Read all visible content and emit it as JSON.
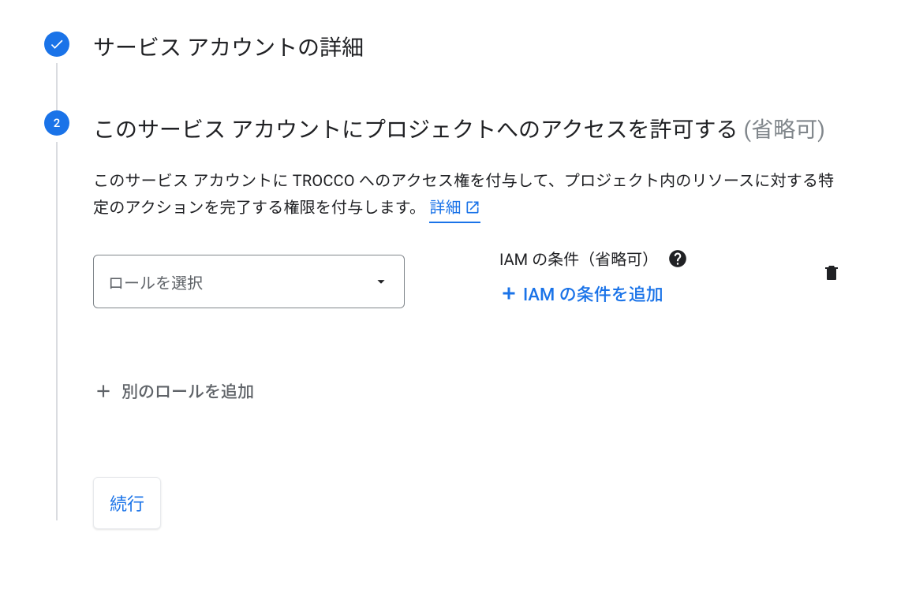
{
  "step1": {
    "title": "サービス アカウントの詳細"
  },
  "step2": {
    "number": "2",
    "title_main": "このサービス アカウントにプロジェクトへのアクセスを許可する",
    "title_optional": "(省略可)",
    "description_text": "このサービス アカウントに TROCCO へのアクセス権を付与して、プロジェクト内のリソースに対する特定のアクションを完了する権限を付与します。",
    "details_link": "詳細",
    "role_select_placeholder": "ロールを選択",
    "iam_condition_header": "IAM の条件（省略可）",
    "iam_add_condition": "IAM の条件を追加",
    "add_role": "別のロールを追加",
    "continue": "続行"
  },
  "colors": {
    "primary": "#1a73e8"
  }
}
